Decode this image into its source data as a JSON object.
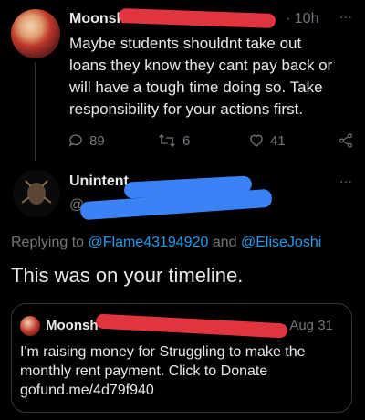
{
  "tweet1": {
    "author_name": "Moonsh",
    "time": "· 10h",
    "more": "···",
    "text": "Maybe students shouldnt take out loans they know they cant pay back or will have a tough time doing so. Take responsibility for your actions first.",
    "replies": "89",
    "retweets": "6",
    "likes": "41"
  },
  "reply": {
    "author_name": "Unintent",
    "handle_prefix": "@",
    "more": "···",
    "replying_to_label": "Replying to",
    "mention1": "@Flame43194920",
    "and_label": "and",
    "mention2": "@EliseJoshi",
    "text": "This was on your timeline."
  },
  "quoted": {
    "author_name": "Moonsh",
    "date": "· Aug 31",
    "text": "I'm raising money for Struggling to make the monthly rent payment. Click to Donate gofund.me/4d79f940"
  },
  "colors": {
    "background": "#000000",
    "text": "#e7e9ea",
    "muted": "#71767b",
    "link": "#1d9bf0",
    "redaction_red": "#e0343f",
    "redaction_blue": "#3b82f6"
  }
}
